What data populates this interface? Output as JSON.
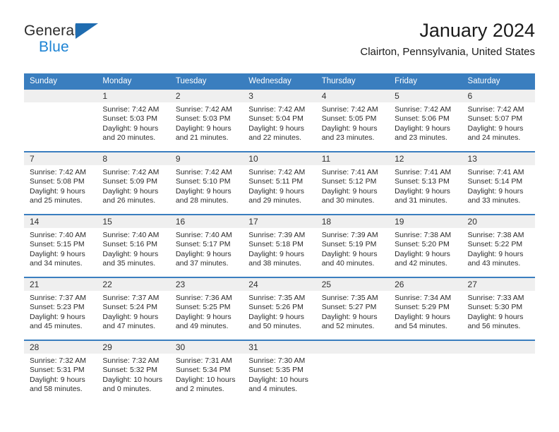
{
  "brand": {
    "name_part1": "General",
    "name_part2": "Blue",
    "triangle_color": "#1f6cb0",
    "blue_text_color": "#1d83d4"
  },
  "header": {
    "title": "January 2024",
    "subtitle": "Clairton, Pennsylvania, United States"
  },
  "theme": {
    "header_blue": "#3a7ebf",
    "daynum_band": "#efefef",
    "text": "#2b2b2b"
  },
  "weekday_headers": [
    "Sunday",
    "Monday",
    "Tuesday",
    "Wednesday",
    "Thursday",
    "Friday",
    "Saturday"
  ],
  "weeks": [
    [
      {
        "day": "",
        "sunrise": "",
        "sunset": "",
        "daylight_line1": "",
        "daylight_line2": ""
      },
      {
        "day": "1",
        "sunrise": "Sunrise: 7:42 AM",
        "sunset": "Sunset: 5:03 PM",
        "daylight_line1": "Daylight: 9 hours",
        "daylight_line2": "and 20 minutes."
      },
      {
        "day": "2",
        "sunrise": "Sunrise: 7:42 AM",
        "sunset": "Sunset: 5:03 PM",
        "daylight_line1": "Daylight: 9 hours",
        "daylight_line2": "and 21 minutes."
      },
      {
        "day": "3",
        "sunrise": "Sunrise: 7:42 AM",
        "sunset": "Sunset: 5:04 PM",
        "daylight_line1": "Daylight: 9 hours",
        "daylight_line2": "and 22 minutes."
      },
      {
        "day": "4",
        "sunrise": "Sunrise: 7:42 AM",
        "sunset": "Sunset: 5:05 PM",
        "daylight_line1": "Daylight: 9 hours",
        "daylight_line2": "and 23 minutes."
      },
      {
        "day": "5",
        "sunrise": "Sunrise: 7:42 AM",
        "sunset": "Sunset: 5:06 PM",
        "daylight_line1": "Daylight: 9 hours",
        "daylight_line2": "and 23 minutes."
      },
      {
        "day": "6",
        "sunrise": "Sunrise: 7:42 AM",
        "sunset": "Sunset: 5:07 PM",
        "daylight_line1": "Daylight: 9 hours",
        "daylight_line2": "and 24 minutes."
      }
    ],
    [
      {
        "day": "7",
        "sunrise": "Sunrise: 7:42 AM",
        "sunset": "Sunset: 5:08 PM",
        "daylight_line1": "Daylight: 9 hours",
        "daylight_line2": "and 25 minutes."
      },
      {
        "day": "8",
        "sunrise": "Sunrise: 7:42 AM",
        "sunset": "Sunset: 5:09 PM",
        "daylight_line1": "Daylight: 9 hours",
        "daylight_line2": "and 26 minutes."
      },
      {
        "day": "9",
        "sunrise": "Sunrise: 7:42 AM",
        "sunset": "Sunset: 5:10 PM",
        "daylight_line1": "Daylight: 9 hours",
        "daylight_line2": "and 28 minutes."
      },
      {
        "day": "10",
        "sunrise": "Sunrise: 7:42 AM",
        "sunset": "Sunset: 5:11 PM",
        "daylight_line1": "Daylight: 9 hours",
        "daylight_line2": "and 29 minutes."
      },
      {
        "day": "11",
        "sunrise": "Sunrise: 7:41 AM",
        "sunset": "Sunset: 5:12 PM",
        "daylight_line1": "Daylight: 9 hours",
        "daylight_line2": "and 30 minutes."
      },
      {
        "day": "12",
        "sunrise": "Sunrise: 7:41 AM",
        "sunset": "Sunset: 5:13 PM",
        "daylight_line1": "Daylight: 9 hours",
        "daylight_line2": "and 31 minutes."
      },
      {
        "day": "13",
        "sunrise": "Sunrise: 7:41 AM",
        "sunset": "Sunset: 5:14 PM",
        "daylight_line1": "Daylight: 9 hours",
        "daylight_line2": "and 33 minutes."
      }
    ],
    [
      {
        "day": "14",
        "sunrise": "Sunrise: 7:40 AM",
        "sunset": "Sunset: 5:15 PM",
        "daylight_line1": "Daylight: 9 hours",
        "daylight_line2": "and 34 minutes."
      },
      {
        "day": "15",
        "sunrise": "Sunrise: 7:40 AM",
        "sunset": "Sunset: 5:16 PM",
        "daylight_line1": "Daylight: 9 hours",
        "daylight_line2": "and 35 minutes."
      },
      {
        "day": "16",
        "sunrise": "Sunrise: 7:40 AM",
        "sunset": "Sunset: 5:17 PM",
        "daylight_line1": "Daylight: 9 hours",
        "daylight_line2": "and 37 minutes."
      },
      {
        "day": "17",
        "sunrise": "Sunrise: 7:39 AM",
        "sunset": "Sunset: 5:18 PM",
        "daylight_line1": "Daylight: 9 hours",
        "daylight_line2": "and 38 minutes."
      },
      {
        "day": "18",
        "sunrise": "Sunrise: 7:39 AM",
        "sunset": "Sunset: 5:19 PM",
        "daylight_line1": "Daylight: 9 hours",
        "daylight_line2": "and 40 minutes."
      },
      {
        "day": "19",
        "sunrise": "Sunrise: 7:38 AM",
        "sunset": "Sunset: 5:20 PM",
        "daylight_line1": "Daylight: 9 hours",
        "daylight_line2": "and 42 minutes."
      },
      {
        "day": "20",
        "sunrise": "Sunrise: 7:38 AM",
        "sunset": "Sunset: 5:22 PM",
        "daylight_line1": "Daylight: 9 hours",
        "daylight_line2": "and 43 minutes."
      }
    ],
    [
      {
        "day": "21",
        "sunrise": "Sunrise: 7:37 AM",
        "sunset": "Sunset: 5:23 PM",
        "daylight_line1": "Daylight: 9 hours",
        "daylight_line2": "and 45 minutes."
      },
      {
        "day": "22",
        "sunrise": "Sunrise: 7:37 AM",
        "sunset": "Sunset: 5:24 PM",
        "daylight_line1": "Daylight: 9 hours",
        "daylight_line2": "and 47 minutes."
      },
      {
        "day": "23",
        "sunrise": "Sunrise: 7:36 AM",
        "sunset": "Sunset: 5:25 PM",
        "daylight_line1": "Daylight: 9 hours",
        "daylight_line2": "and 49 minutes."
      },
      {
        "day": "24",
        "sunrise": "Sunrise: 7:35 AM",
        "sunset": "Sunset: 5:26 PM",
        "daylight_line1": "Daylight: 9 hours",
        "daylight_line2": "and 50 minutes."
      },
      {
        "day": "25",
        "sunrise": "Sunrise: 7:35 AM",
        "sunset": "Sunset: 5:27 PM",
        "daylight_line1": "Daylight: 9 hours",
        "daylight_line2": "and 52 minutes."
      },
      {
        "day": "26",
        "sunrise": "Sunrise: 7:34 AM",
        "sunset": "Sunset: 5:29 PM",
        "daylight_line1": "Daylight: 9 hours",
        "daylight_line2": "and 54 minutes."
      },
      {
        "day": "27",
        "sunrise": "Sunrise: 7:33 AM",
        "sunset": "Sunset: 5:30 PM",
        "daylight_line1": "Daylight: 9 hours",
        "daylight_line2": "and 56 minutes."
      }
    ],
    [
      {
        "day": "28",
        "sunrise": "Sunrise: 7:32 AM",
        "sunset": "Sunset: 5:31 PM",
        "daylight_line1": "Daylight: 9 hours",
        "daylight_line2": "and 58 minutes."
      },
      {
        "day": "29",
        "sunrise": "Sunrise: 7:32 AM",
        "sunset": "Sunset: 5:32 PM",
        "daylight_line1": "Daylight: 10 hours",
        "daylight_line2": "and 0 minutes."
      },
      {
        "day": "30",
        "sunrise": "Sunrise: 7:31 AM",
        "sunset": "Sunset: 5:34 PM",
        "daylight_line1": "Daylight: 10 hours",
        "daylight_line2": "and 2 minutes."
      },
      {
        "day": "31",
        "sunrise": "Sunrise: 7:30 AM",
        "sunset": "Sunset: 5:35 PM",
        "daylight_line1": "Daylight: 10 hours",
        "daylight_line2": "and 4 minutes."
      },
      {
        "day": "",
        "sunrise": "",
        "sunset": "",
        "daylight_line1": "",
        "daylight_line2": ""
      },
      {
        "day": "",
        "sunrise": "",
        "sunset": "",
        "daylight_line1": "",
        "daylight_line2": ""
      },
      {
        "day": "",
        "sunrise": "",
        "sunset": "",
        "daylight_line1": "",
        "daylight_line2": ""
      }
    ]
  ]
}
